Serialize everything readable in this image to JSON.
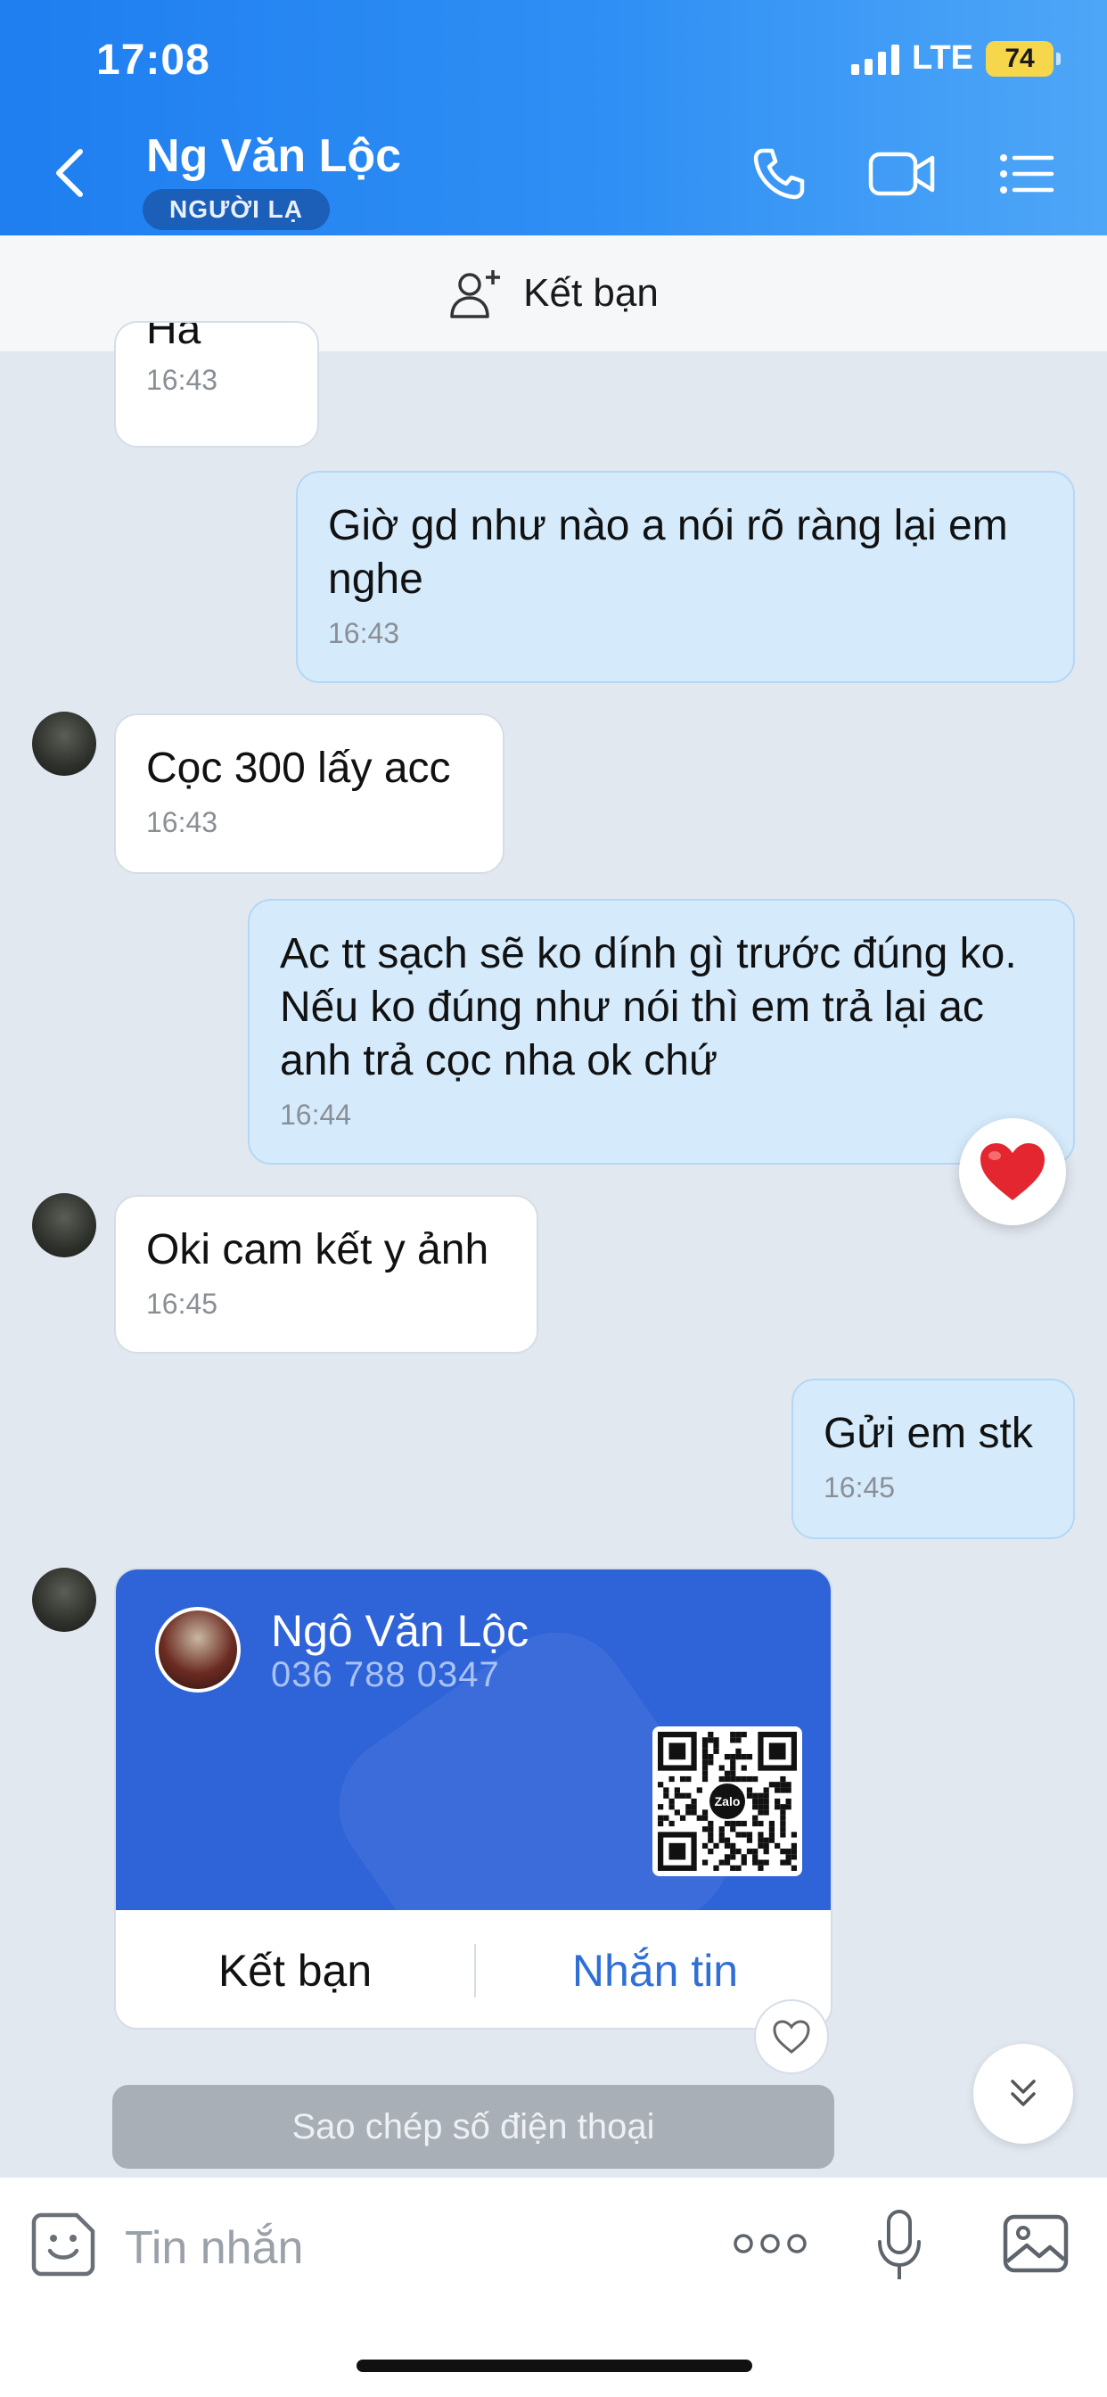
{
  "status_bar": {
    "time": "17:08",
    "network": "LTE",
    "battery": "74"
  },
  "header": {
    "contact_name": "Ng Văn Lộc",
    "badge": "NGƯỜI LẠ"
  },
  "add_friend_bar": {
    "label": "Kết bạn"
  },
  "messages": [
    {
      "side": "in",
      "text": "Ha",
      "time": "16:43"
    },
    {
      "side": "out",
      "text": "Giờ gd như nào a nói rõ ràng lại em nghe",
      "time": "16:43"
    },
    {
      "side": "in",
      "text": "Cọc 300 lấy acc",
      "time": "16:43"
    },
    {
      "side": "out",
      "text": "Ac tt sạch sẽ ko dính gì trước đúng ko. Nếu ko đúng như nói thì em trả lại ac anh trả cọc nha ok chứ",
      "time": "16:44",
      "reaction": "heart"
    },
    {
      "side": "in",
      "text": "Oki cam kết y ảnh",
      "time": "16:45"
    },
    {
      "side": "out",
      "text": "Gửi em stk",
      "time": "16:45"
    }
  ],
  "contact_card": {
    "name": "Ngô Văn Lộc",
    "phone": "036 788 0347",
    "qr_logo": "Zalo",
    "add_friend_label": "Kết bạn",
    "message_label": "Nhắn tin"
  },
  "copy_phone_label": "Sao chép số điện thoại",
  "composer": {
    "placeholder": "Tin nhắn"
  },
  "colors": {
    "header_blue": "#2f8ff4",
    "card_blue": "#2f63d8",
    "link_blue": "#2f6fd6",
    "out_bubble": "#d5ebfc"
  }
}
